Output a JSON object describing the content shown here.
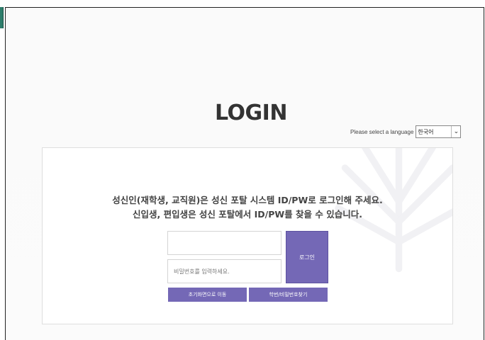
{
  "page": {
    "title": "LOGIN"
  },
  "language": {
    "label": "Please select a language",
    "selected": "한국어"
  },
  "notice": {
    "line1": "성신인(재학생, 교직원)은 성신 포탈 시스템 ID/PW로 로그인해 주세요.",
    "line2": "신입생, 편입생은 성신 포탈에서 ID/PW를 찾을 수 있습니다."
  },
  "form": {
    "id_value": "",
    "password_placeholder": "비밀번호를 입력하세요.",
    "login_label": "로그인",
    "home_label": "초기화면으로 이동",
    "find_label": "학번/비밀번호찾기"
  },
  "colors": {
    "accent": "#7468b6",
    "corner_tab": "#2e7d6b"
  }
}
